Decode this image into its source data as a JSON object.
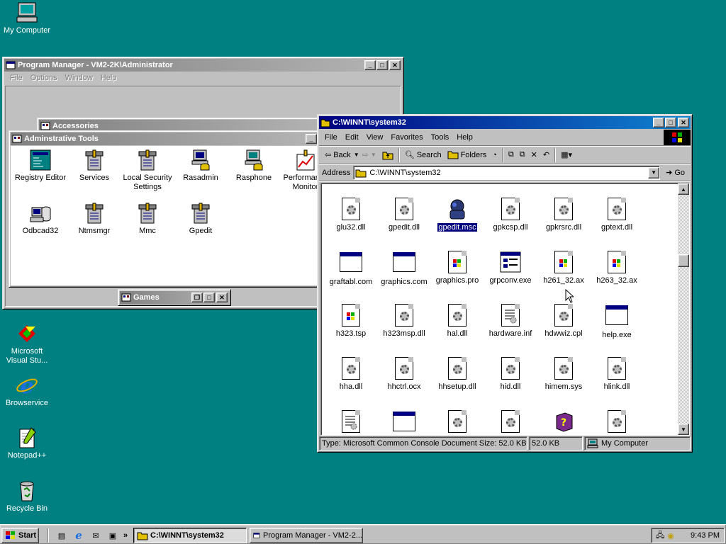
{
  "desktop": {
    "icons": [
      {
        "label": "My Computer",
        "icon": "my-computer-icon"
      },
      {
        "label": "Microsoft Visual Stu...",
        "icon": "visual-studio-icon"
      },
      {
        "label": "Browservice",
        "icon": "internet-explorer-icon"
      },
      {
        "label": "Notepad++",
        "icon": "notepad-plus-plus-icon"
      },
      {
        "label": "Recycle Bin",
        "icon": "recycle-bin-icon"
      }
    ]
  },
  "program_manager": {
    "title": "Program Manager - VM2-2K\\Administrator",
    "menu": [
      "File",
      "Options",
      "Window",
      "Help"
    ],
    "groups": {
      "accessories": {
        "title": "Accessories"
      },
      "games": {
        "title": "Games"
      },
      "admin_tools": {
        "title": "Adminstrative Tools",
        "items": [
          {
            "label": "Registry Editor",
            "icon": "registry-editor-icon"
          },
          {
            "label": "Services",
            "icon": "admin-tool-icon"
          },
          {
            "label": "Local Security Settings",
            "icon": "admin-tool-icon"
          },
          {
            "label": "Rasadmin",
            "icon": "computer-phone-icon"
          },
          {
            "label": "Rasphone",
            "icon": "computer-phone-icon"
          },
          {
            "label": "Performance Monitor",
            "icon": "performance-monitor-icon"
          },
          {
            "label": "Odbcad32",
            "icon": "odbc-icon"
          },
          {
            "label": "Ntmsmgr",
            "icon": "admin-tool-icon"
          },
          {
            "label": "Mmc",
            "icon": "admin-tool-icon"
          },
          {
            "label": "Gpedit",
            "icon": "admin-tool-icon"
          }
        ]
      }
    }
  },
  "explorer": {
    "title": "C:\\WINNT\\system32",
    "menu": [
      "File",
      "Edit",
      "View",
      "Favorites",
      "Tools",
      "Help"
    ],
    "toolbar": {
      "back": "Back",
      "search": "Search",
      "folders": "Folders"
    },
    "address": {
      "label": "Address",
      "value": "C:\\WINNT\\system32",
      "go": "Go"
    },
    "files": [
      {
        "name": "glu32.dll",
        "type": "dll"
      },
      {
        "name": "gpedit.dll",
        "type": "dll"
      },
      {
        "name": "gpedit.msc",
        "type": "msc",
        "selected": true
      },
      {
        "name": "gpkcsp.dll",
        "type": "dll"
      },
      {
        "name": "gpkrsrc.dll",
        "type": "dll"
      },
      {
        "name": "gptext.dll",
        "type": "dll"
      },
      {
        "name": "graftabl.com",
        "type": "app"
      },
      {
        "name": "graphics.com",
        "type": "app"
      },
      {
        "name": "graphics.pro",
        "type": "media"
      },
      {
        "name": "grpconv.exe",
        "type": "exe"
      },
      {
        "name": "h261_32.ax",
        "type": "media"
      },
      {
        "name": "h263_32.ax",
        "type": "media"
      },
      {
        "name": "h323.tsp",
        "type": "media"
      },
      {
        "name": "h323msp.dll",
        "type": "dll"
      },
      {
        "name": "hal.dll",
        "type": "dll"
      },
      {
        "name": "hardware.inf",
        "type": "inf"
      },
      {
        "name": "hdwwiz.cpl",
        "type": "dll"
      },
      {
        "name": "help.exe",
        "type": "app"
      },
      {
        "name": "hha.dll",
        "type": "dll"
      },
      {
        "name": "hhctrl.ocx",
        "type": "dll"
      },
      {
        "name": "hhsetup.dll",
        "type": "dll"
      },
      {
        "name": "hid.dll",
        "type": "dll"
      },
      {
        "name": "himem.sys",
        "type": "dll"
      },
      {
        "name": "hlink.dll",
        "type": "dll"
      },
      {
        "name": "",
        "type": "inf"
      },
      {
        "name": "",
        "type": "app"
      },
      {
        "name": "",
        "type": "dll"
      },
      {
        "name": "",
        "type": "dll"
      },
      {
        "name": "",
        "type": "help"
      },
      {
        "name": "",
        "type": "dll"
      }
    ],
    "status": {
      "type_info": "Type: Microsoft Common Console Document Size: 52.0 KB",
      "size": "52.0 KB",
      "zone": "My Computer"
    }
  },
  "taskbar": {
    "start": "Start",
    "tasks": [
      {
        "label": "C:\\WINNT\\system32",
        "active": true
      },
      {
        "label": "Program Manager - VM2-2...",
        "active": false
      }
    ],
    "clock": "9:43 PM"
  }
}
